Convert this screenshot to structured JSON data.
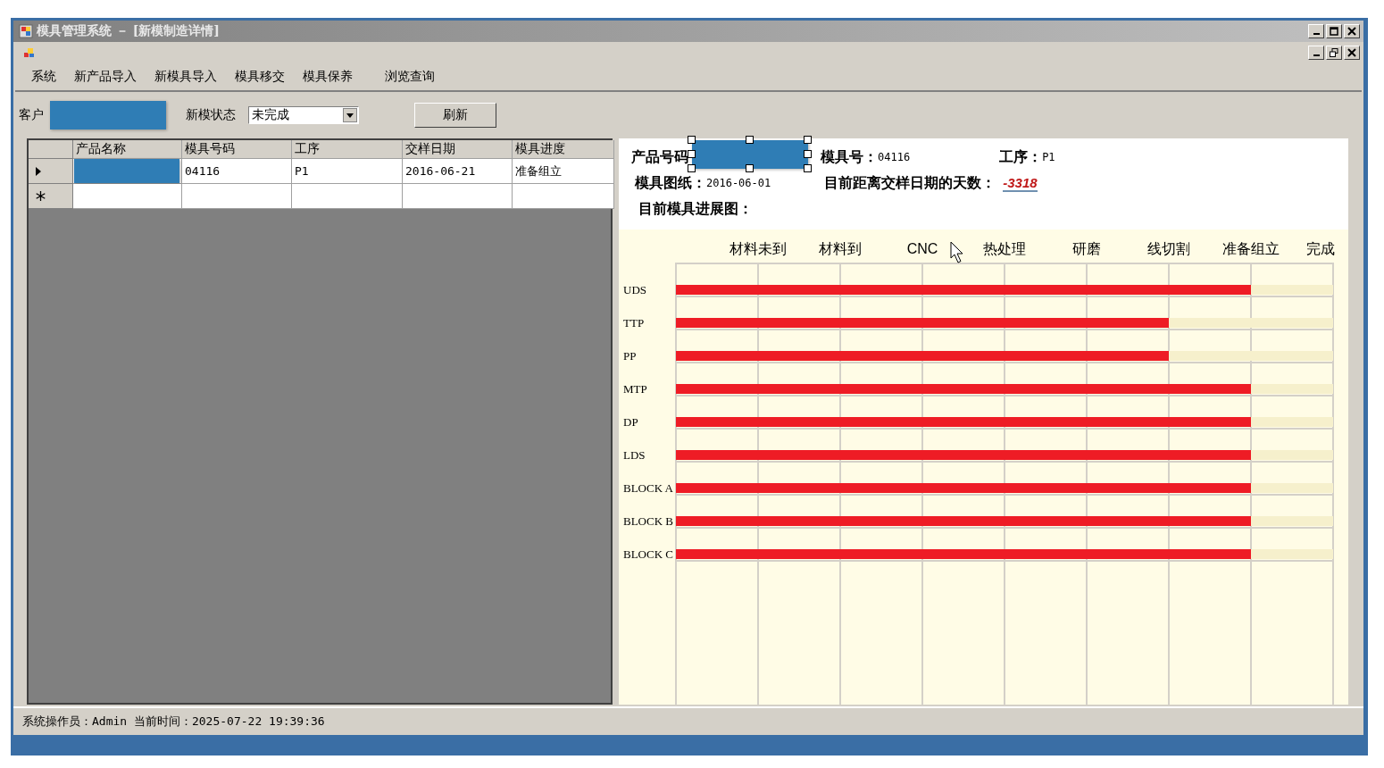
{
  "window": {
    "title": "模具管理系统 － [新模制造详情]"
  },
  "menu": [
    "系统",
    "新产品导入",
    "新模具导入",
    "模具移交",
    "模具保养",
    "浏览查询"
  ],
  "filter": {
    "customer_label": "客户",
    "status_label": "新模状态",
    "status_value": "未完成",
    "refresh_button": "刷新"
  },
  "grid": {
    "columns": [
      "产品名称",
      "模具号码",
      "工序",
      "交样日期",
      "模具进度"
    ],
    "rows": [
      {
        "kind": "current",
        "cells": [
          null,
          "04116",
          "P1",
          "2016-06-21",
          "准备组立"
        ]
      },
      {
        "kind": "new"
      }
    ]
  },
  "detail": {
    "product_code_label": "产品号码",
    "mold_no_label": "模具号：",
    "mold_no": "04116",
    "process_label": "工序：",
    "process": "P1",
    "drawing_label": "模具图纸：",
    "drawing": "2016-06-01",
    "days_label": "目前距离交样日期的天数：",
    "days": "-3318",
    "chart_title": "目前模具进展图：",
    "stages": [
      "材料未到",
      "材料到",
      "CNC",
      "热处理",
      "研磨",
      "线切割",
      "准备组立",
      "完成"
    ],
    "parts": [
      {
        "name": "UDS",
        "level": 0.875
      },
      {
        "name": "TTP",
        "level": 0.75
      },
      {
        "name": "PP",
        "level": 0.75
      },
      {
        "name": "MTP",
        "level": 0.875
      },
      {
        "name": "DP",
        "level": 0.875
      },
      {
        "name": "LDS",
        "level": 0.875
      },
      {
        "name": "BLOCK A",
        "level": 0.875
      },
      {
        "name": "BLOCK B",
        "level": 0.875
      },
      {
        "name": "BLOCK C",
        "level": 0.875
      }
    ]
  },
  "status_bar": "系统操作员：Admin 当前时间：2025-07-22 19:39:36"
}
